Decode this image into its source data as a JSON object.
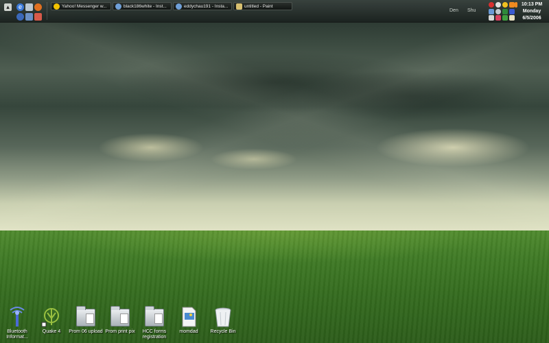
{
  "taskbar": {
    "tasks": [
      {
        "label": "Yahoo! Messenger w...",
        "icon": "yahoo-smiley-icon",
        "color": "#f2c200"
      },
      {
        "label": "black186white - Inst...",
        "icon": "im-chat-icon",
        "color": "#6fa0d8"
      },
      {
        "label": "eddychau191 - Insta...",
        "icon": "im-chat-icon",
        "color": "#6fa0d8"
      },
      {
        "label": "untitled - Paint",
        "icon": "paint-icon",
        "color": "#d8c070"
      }
    ],
    "quick_launch": [
      "show-desktop-icon",
      "globe-icon",
      "recycle-icon",
      "firefox-icon",
      "messenger-icon",
      "media-icon",
      "app-icon"
    ],
    "buttons": {
      "left": "Den",
      "right": "Shu"
    }
  },
  "tray": {
    "icons": [
      "close-red-icon",
      "circle-icon",
      "smiley-icon",
      "audio-icon",
      "arrows-icon",
      "network-icon",
      "ring-icon",
      "shield-icon",
      "bluetooth-icon",
      "volume-icon",
      "chat-icon",
      "power-icon",
      "doc-icon"
    ]
  },
  "clock": {
    "time": "10:13 PM",
    "day": "Monday",
    "date": "6/5/2006"
  },
  "desktop_icons": [
    {
      "label": "Bluetooth Informat...",
      "icon": "bluetooth-icon"
    },
    {
      "label": "Quake 4",
      "icon": "quake-icon"
    },
    {
      "label": "Prom 06 upload",
      "icon": "folder-icon"
    },
    {
      "label": "Prom print pix",
      "icon": "folder-icon"
    },
    {
      "label": "HCC forms registration",
      "icon": "folder-icon"
    },
    {
      "label": "momdad",
      "icon": "jpeg-file-icon"
    },
    {
      "label": "Recycle Bin",
      "icon": "recycle-bin-icon"
    }
  ]
}
